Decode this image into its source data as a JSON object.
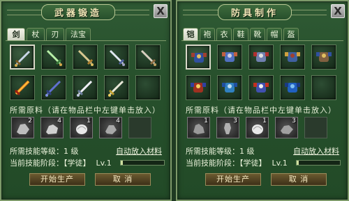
{
  "left": {
    "title": "武器锻造",
    "close_label": "X",
    "tabs": [
      "剑",
      "杖",
      "刃",
      "法宝"
    ],
    "active_tab": 0,
    "items": [
      "sword-item",
      "sword-item",
      "sword-item",
      "sword-item",
      "sword-item",
      "fire-sword-item",
      "sword-item",
      "sword-item",
      "sword-item",
      "empty-slot"
    ],
    "materials_heading": "所需原料（请在物品栏中左键单击放入）",
    "materials": [
      {
        "count": "2",
        "icon": "ore-icon"
      },
      {
        "count": "4",
        "icon": "ore-icon"
      },
      {
        "count": "1",
        "icon": "shell-icon"
      },
      {
        "count": "4",
        "icon": "ore-icon"
      },
      {
        "count": "",
        "icon": "empty-slot"
      }
    ],
    "skill_level": "所需技能等级：1 级",
    "auto_place": "自动放入材料",
    "stage_label": "当前技能阶段：【学徒】",
    "stage_lv": "Lv.1",
    "progress": 0.05,
    "start_button": "开始生产",
    "cancel_button": "取 消"
  },
  "right": {
    "title": "防具制作",
    "close_label": "X",
    "tabs": [
      "铠",
      "袍",
      "衣",
      "鞋",
      "靴",
      "帽",
      "盔"
    ],
    "active_tab": 0,
    "items": [
      "armor-item",
      "armor-item",
      "armor-item",
      "armor-item",
      "armor-item",
      "armor-item",
      "armor-item",
      "armor-item",
      "armor-item",
      "empty-slot"
    ],
    "materials_heading": "所需原料（请在物品栏中左键单击放入）",
    "materials": [
      {
        "count": "1",
        "icon": "ore-icon"
      },
      {
        "count": "3",
        "icon": "ore-icon"
      },
      {
        "count": "1",
        "icon": "shell-icon"
      },
      {
        "count": "3",
        "icon": "ore-icon"
      },
      {
        "count": "",
        "icon": "empty-slot"
      }
    ],
    "skill_level": "所需技能等级：1 级",
    "auto_place": "自动放入材料",
    "stage_label": "当前技能阶段：【学徒】",
    "stage_lv": "Lv.1",
    "progress": 0.05,
    "start_button": "开始生产",
    "cancel_button": "取 消"
  },
  "colors": {
    "panel_bg": "#27502c",
    "border": "#7e9a6a",
    "text": "#e8f0d8",
    "title": "#f3e8b8"
  }
}
